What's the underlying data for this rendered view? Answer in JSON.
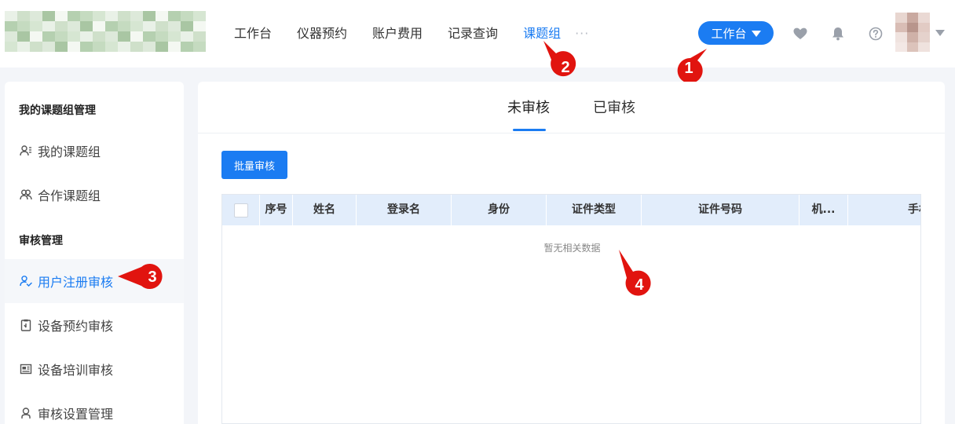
{
  "header": {
    "nav": [
      {
        "label": "工作台",
        "active": false
      },
      {
        "label": "仪器预约",
        "active": false
      },
      {
        "label": "账户费用",
        "active": false
      },
      {
        "label": "记录查询",
        "active": false
      },
      {
        "label": "课题组",
        "active": true
      }
    ],
    "more": "···",
    "workspace_button": "工作台",
    "icons": [
      "heart-icon",
      "bell-icon",
      "help-icon"
    ]
  },
  "sidebar": {
    "section_groups": "我的课题组管理",
    "section_review": "审核管理",
    "items": [
      {
        "label": "我的课题组",
        "icon": "user-list-icon"
      },
      {
        "label": "合作课题组",
        "icon": "users-icon"
      },
      {
        "label": "用户注册审核",
        "icon": "user-check-icon",
        "active": true
      },
      {
        "label": "设备预约审核",
        "icon": "clipboard-icon"
      },
      {
        "label": "设备培训审核",
        "icon": "training-icon"
      },
      {
        "label": "审核设置管理",
        "icon": "settings-user-icon"
      }
    ]
  },
  "main": {
    "tabs": [
      {
        "label": "未审核",
        "active": true
      },
      {
        "label": "已审核",
        "active": false
      }
    ],
    "batch_button": "批量审核",
    "table": {
      "columns": [
        "序号",
        "姓名",
        "登录名",
        "身份",
        "证件类型",
        "证件号码",
        "机...",
        "手机"
      ],
      "empty_text": "暂无相关数据"
    }
  },
  "annotations": [
    "1",
    "2",
    "3",
    "4"
  ],
  "colors": {
    "accent": "#1b7cf2",
    "marker": "#e1140f",
    "table_header_bg": "#e2edfb"
  }
}
